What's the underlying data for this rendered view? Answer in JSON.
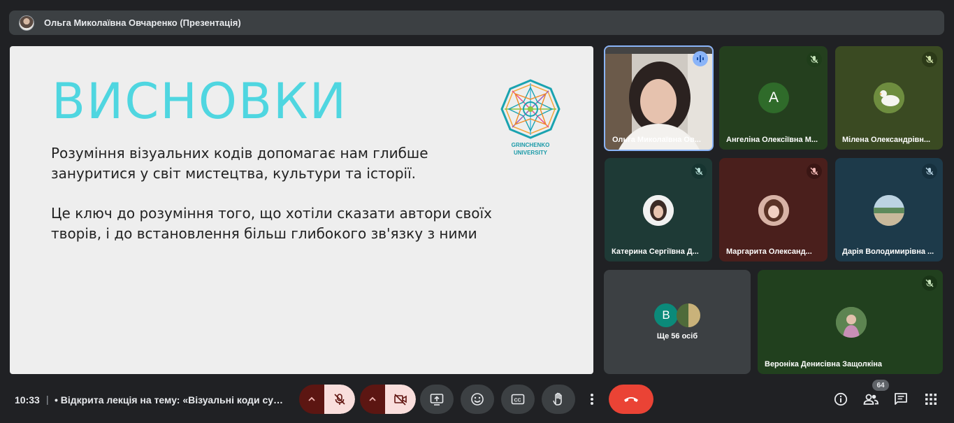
{
  "presenter_bar": {
    "name": "Ольга Миколаївна Овчаренко (Презентація)"
  },
  "slide": {
    "title": "ВИСНОВКИ",
    "paragraph1": "Розуміння візуальних кодів допомагає нам глибше зануритися у світ мистецтва, культури та історії.",
    "paragraph2": "Це ключ до розуміння того, що хотіли сказати автори своїх творів, і до встановлення більш глибокого зв'язку з ними",
    "logo_text_line1": "GRINCHENKO",
    "logo_text_line2": "UNIVERSITY"
  },
  "participants": [
    {
      "name": "Ольга Миколаївна Ов...",
      "status": "speaking"
    },
    {
      "name": "Ангеліна Олексіївна М...",
      "avatar_letter": "А",
      "status": "muted"
    },
    {
      "name": "Мілена Олександрівн...",
      "status": "muted"
    },
    {
      "name": "Катерина Сергіївна Д...",
      "status": "muted"
    },
    {
      "name": "Маргарита Олександ...",
      "status": "muted"
    },
    {
      "name": "Дарія Володимирівна ...",
      "status": "muted"
    },
    {
      "name": "Вероніка Денисівна Защолкіна",
      "status": "muted"
    }
  ],
  "others_tile": {
    "avatar_letter": "В",
    "label": "Ще 56 осіб"
  },
  "bottom_bar": {
    "time": "10:33",
    "separator": "|",
    "meeting_title": "• Відкрита лекція на тему: «Візуальні коди сучасного мистецтва»",
    "participants_count": "64"
  },
  "colors": {
    "background": "#202124",
    "slide_title": "#4fd6e0",
    "hangup": "#ea4335",
    "mic_off_bg": "#f9dedc"
  }
}
